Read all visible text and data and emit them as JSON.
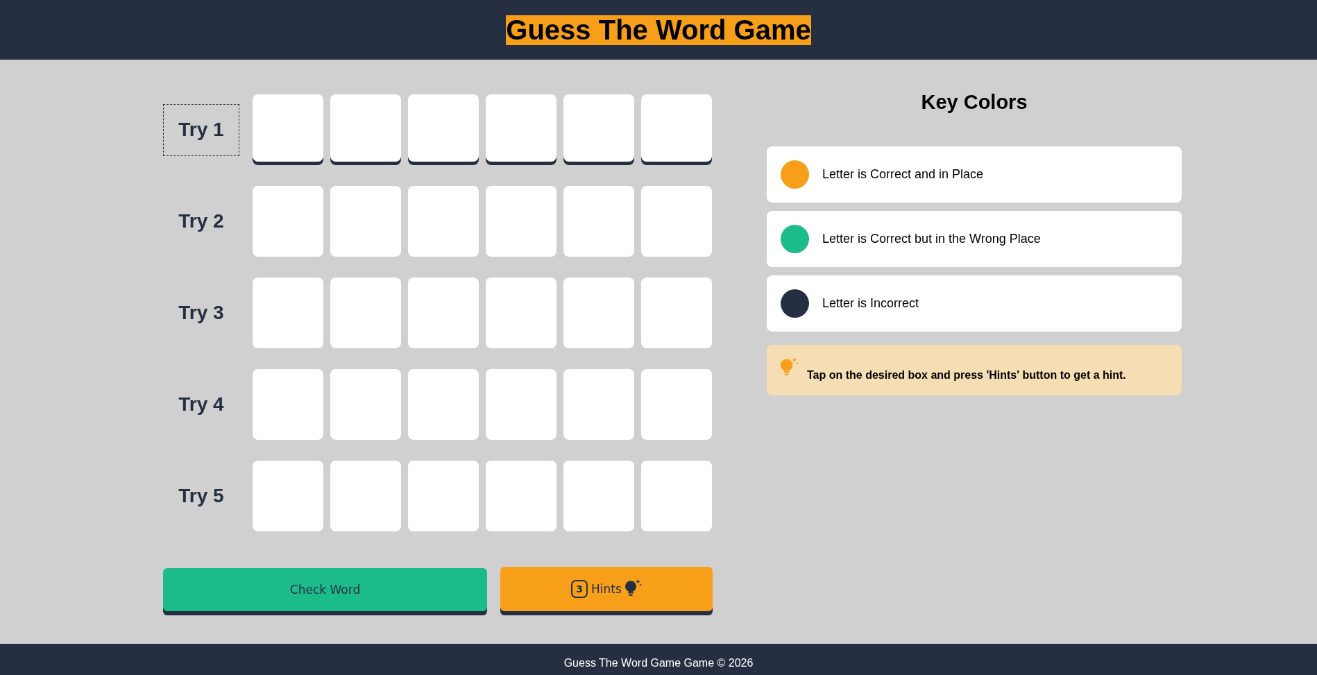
{
  "header": {
    "title": "Guess The Word Game"
  },
  "tries": [
    {
      "label": "Try 1",
      "selected": true,
      "tiles": [
        {
          "disabled": false
        },
        {
          "disabled": false
        },
        {
          "disabled": false
        },
        {
          "disabled": false
        },
        {
          "disabled": false
        },
        {
          "disabled": false
        }
      ]
    },
    {
      "label": "Try 2",
      "selected": false,
      "tiles": [
        {
          "disabled": true
        },
        {
          "disabled": true
        },
        {
          "disabled": true
        },
        {
          "disabled": true
        },
        {
          "disabled": true
        },
        {
          "disabled": true
        }
      ]
    },
    {
      "label": "Try 3",
      "selected": false,
      "tiles": [
        {
          "disabled": true
        },
        {
          "disabled": true
        },
        {
          "disabled": true
        },
        {
          "disabled": true
        },
        {
          "disabled": true
        },
        {
          "disabled": true
        }
      ]
    },
    {
      "label": "Try 4",
      "selected": false,
      "tiles": [
        {
          "disabled": true
        },
        {
          "disabled": true
        },
        {
          "disabled": true
        },
        {
          "disabled": true
        },
        {
          "disabled": true
        },
        {
          "disabled": true
        }
      ]
    },
    {
      "label": "Try 5",
      "selected": false,
      "tiles": [
        {
          "disabled": true
        },
        {
          "disabled": true
        },
        {
          "disabled": true
        },
        {
          "disabled": true
        },
        {
          "disabled": true
        },
        {
          "disabled": true
        }
      ]
    }
  ],
  "actions": {
    "check": {
      "label": "Check Word"
    },
    "hints": {
      "count": "3",
      "label": "Hints"
    }
  },
  "key_colors": {
    "title": "Key Colors",
    "items": [
      {
        "text": "Letter is Correct and in Place",
        "color": "#f89f1a"
      },
      {
        "text": "Letter is Correct but in the Wrong Place",
        "color": "#1bbb8a"
      },
      {
        "text": "Letter is Incorrect",
        "color": "#252f41"
      }
    ]
  },
  "hint": {
    "text": "Tap on the desired box and press 'Hints' button to get a hint."
  },
  "footer": {
    "text": "Guess The Word Game Game © 2026"
  }
}
